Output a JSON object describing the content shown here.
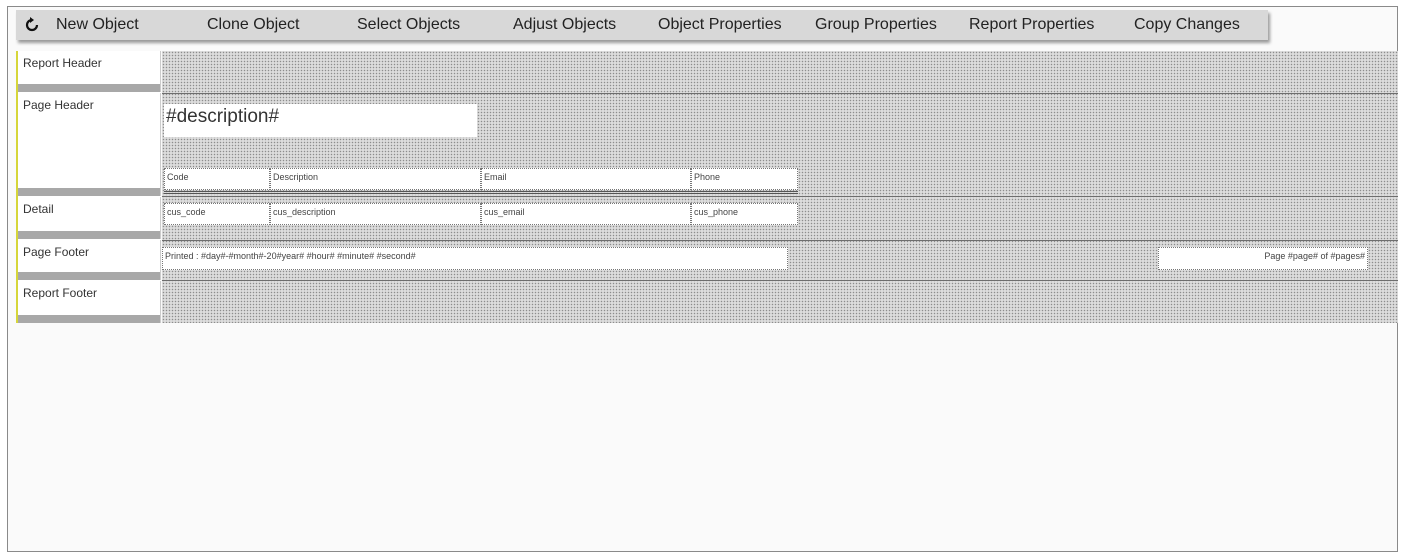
{
  "toolbar": {
    "refresh_icon": "refresh-icon",
    "new_object": "New Object",
    "clone_object": "Clone Object",
    "select_objects": "Select Objects",
    "adjust_objects": "Adjust Objects",
    "object_properties": "Object Properties",
    "group_properties": "Group Properties",
    "report_properties": "Report Properties",
    "copy_changes": "Copy Changes"
  },
  "bands": {
    "report_header": "Report Header",
    "page_header": "Page Header",
    "detail": "Detail",
    "page_footer": "Page Footer",
    "report_footer": "Report Footer"
  },
  "page_header": {
    "title": "#description#",
    "columns": [
      "Code",
      "Description",
      "Email",
      "Phone"
    ]
  },
  "detail": {
    "fields": [
      "cus_code",
      "cus_description",
      "cus_email",
      "cus_phone"
    ]
  },
  "page_footer": {
    "printed": "Printed : #day#-#month#-20#year# #hour# #minute# #second#",
    "page": "Page #page# of #pages#"
  },
  "colors": {
    "toolbar_bg": "#d8d8d8",
    "band_bar": "#a8a8a8",
    "label_accent": "#d6d63a"
  }
}
